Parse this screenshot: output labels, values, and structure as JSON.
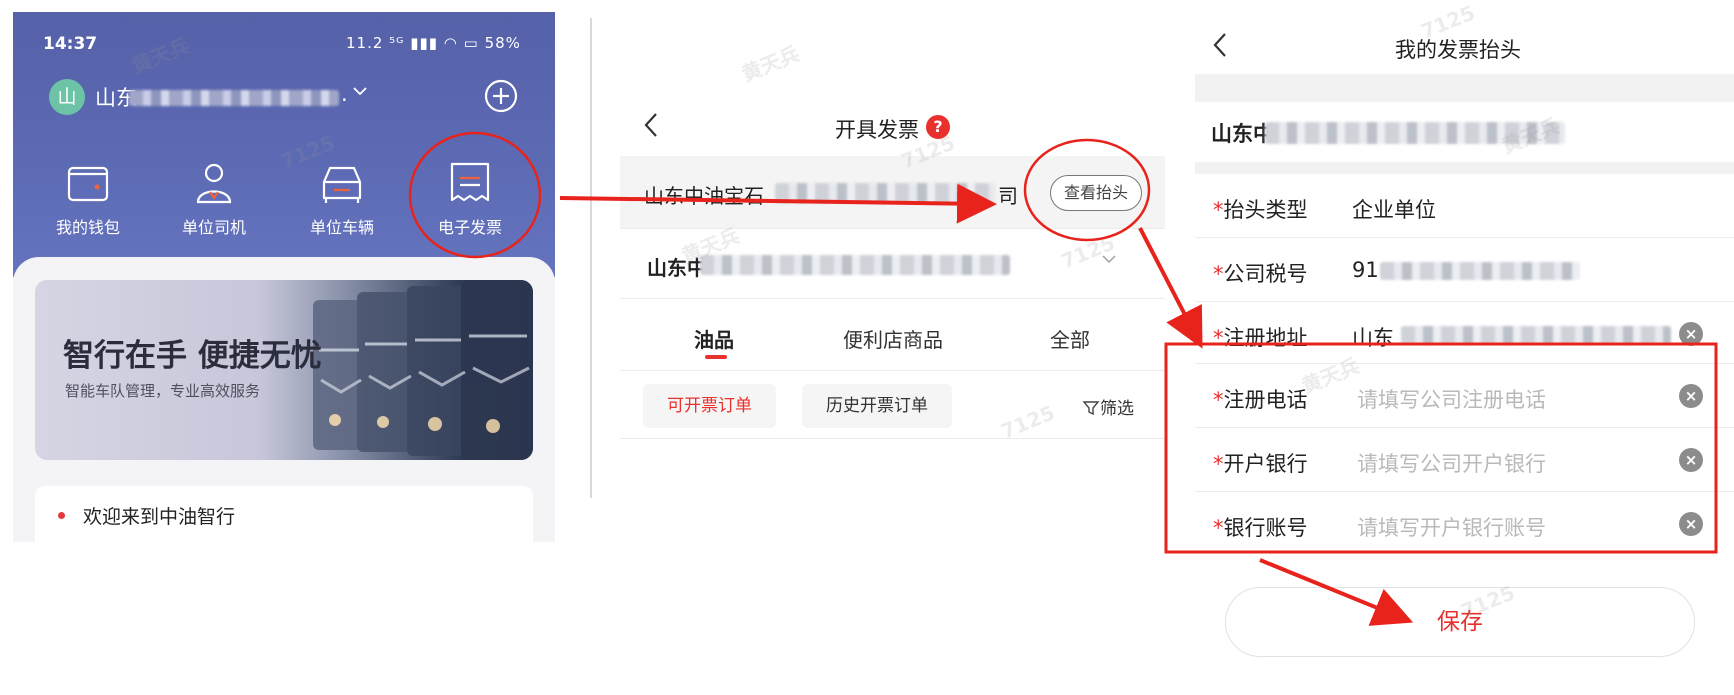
{
  "panel1": {
    "status": {
      "time": "14:37",
      "icons": "11.2 ⁵ᴳ ▮▮▮ ◠ ▭ 58%"
    },
    "account": {
      "avatar_letter": "山",
      "company_prefix": "山东",
      "company_suffix": "."
    },
    "shortcuts": [
      {
        "label": "我的钱包",
        "icon": "wallet-icon"
      },
      {
        "label": "单位司机",
        "icon": "driver-icon"
      },
      {
        "label": "单位车辆",
        "icon": "car-icon"
      },
      {
        "label": "电子发票",
        "icon": "invoice-icon"
      }
    ],
    "banner": {
      "title": "智行在手 便捷无忧",
      "subtitle": "智能车队管理，专业高效服务"
    },
    "welcome": "欢迎来到中油智行"
  },
  "panel2": {
    "title": "开具发票",
    "help": "?",
    "invoice_header_row": {
      "company_prefix": "山东中油宝石",
      "company_suffix": "司",
      "button": "查看抬头"
    },
    "buyer_row": {
      "company_prefix": "山东中"
    },
    "tabs": [
      "油品",
      "便利店商品",
      "全部"
    ],
    "active_tab": "油品",
    "filters": {
      "invoiceable": "可开票订单",
      "history": "历史开票订单",
      "filter": "筛选"
    }
  },
  "panel3": {
    "title": "我的发票抬头",
    "company_prefix": "山东中",
    "fields": [
      {
        "label": "抬头类型",
        "value": "企业单位",
        "placeholder": ""
      },
      {
        "label": "公司税号",
        "value": "91",
        "placeholder": ""
      },
      {
        "label": "注册地址",
        "value": "山东",
        "placeholder": ""
      },
      {
        "label": "注册电话",
        "value": "",
        "placeholder": "请填写公司注册电话"
      },
      {
        "label": "开户银行",
        "value": "",
        "placeholder": "请填写公司开户银行"
      },
      {
        "label": "银行账号",
        "value": "",
        "placeholder": "请填写开户银行账号"
      }
    ],
    "required_mark": "*",
    "save_label": "保存"
  },
  "watermarks": [
    "黄天兵",
    "7125"
  ],
  "colors": {
    "accent_red": "#e8312d",
    "header_blue": "#5d6bb5",
    "annotation_red": "#e8231c"
  }
}
